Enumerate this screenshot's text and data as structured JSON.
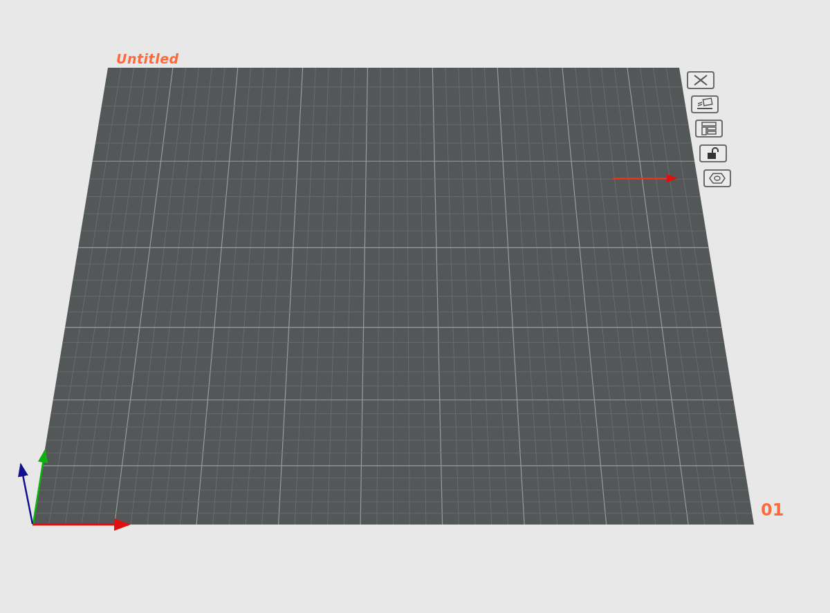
{
  "plate": {
    "title": "Untitled",
    "number": "01"
  }
}
